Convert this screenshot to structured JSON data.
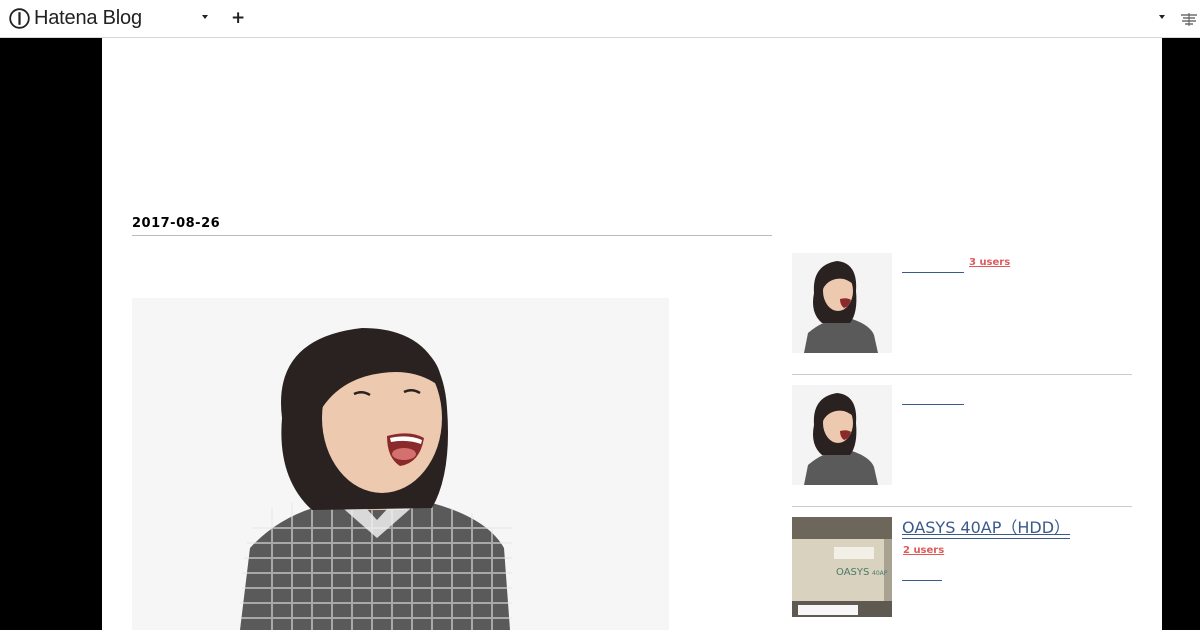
{
  "header": {
    "logo_text": "Hatena Blog",
    "logo_icon": "hatena-logo-icon",
    "menu_caret_icon": "chevron-down-icon",
    "add_icon": "plus-icon",
    "user_caret_icon": "chevron-down-icon",
    "user_icon": "user-icon",
    "plus_glyph": "+"
  },
  "entry": {
    "date": "2017-08-26",
    "photo_icon": "photo-woman-laughing"
  },
  "related": {
    "items": [
      {
        "title": "",
        "users": "3 users",
        "thumb": "photo-woman-laughing"
      },
      {
        "title": "",
        "users": "",
        "thumb": "photo-woman-laughing"
      },
      {
        "title": "OASYS 40AP（HDD）",
        "users": "2 users",
        "thumb": "photo-oasys-device"
      }
    ]
  },
  "colors": {
    "link": "#3a5a8c",
    "users_badge": "#e05a5a",
    "page_bg": "#ffffff",
    "outer_bg": "#000000"
  }
}
